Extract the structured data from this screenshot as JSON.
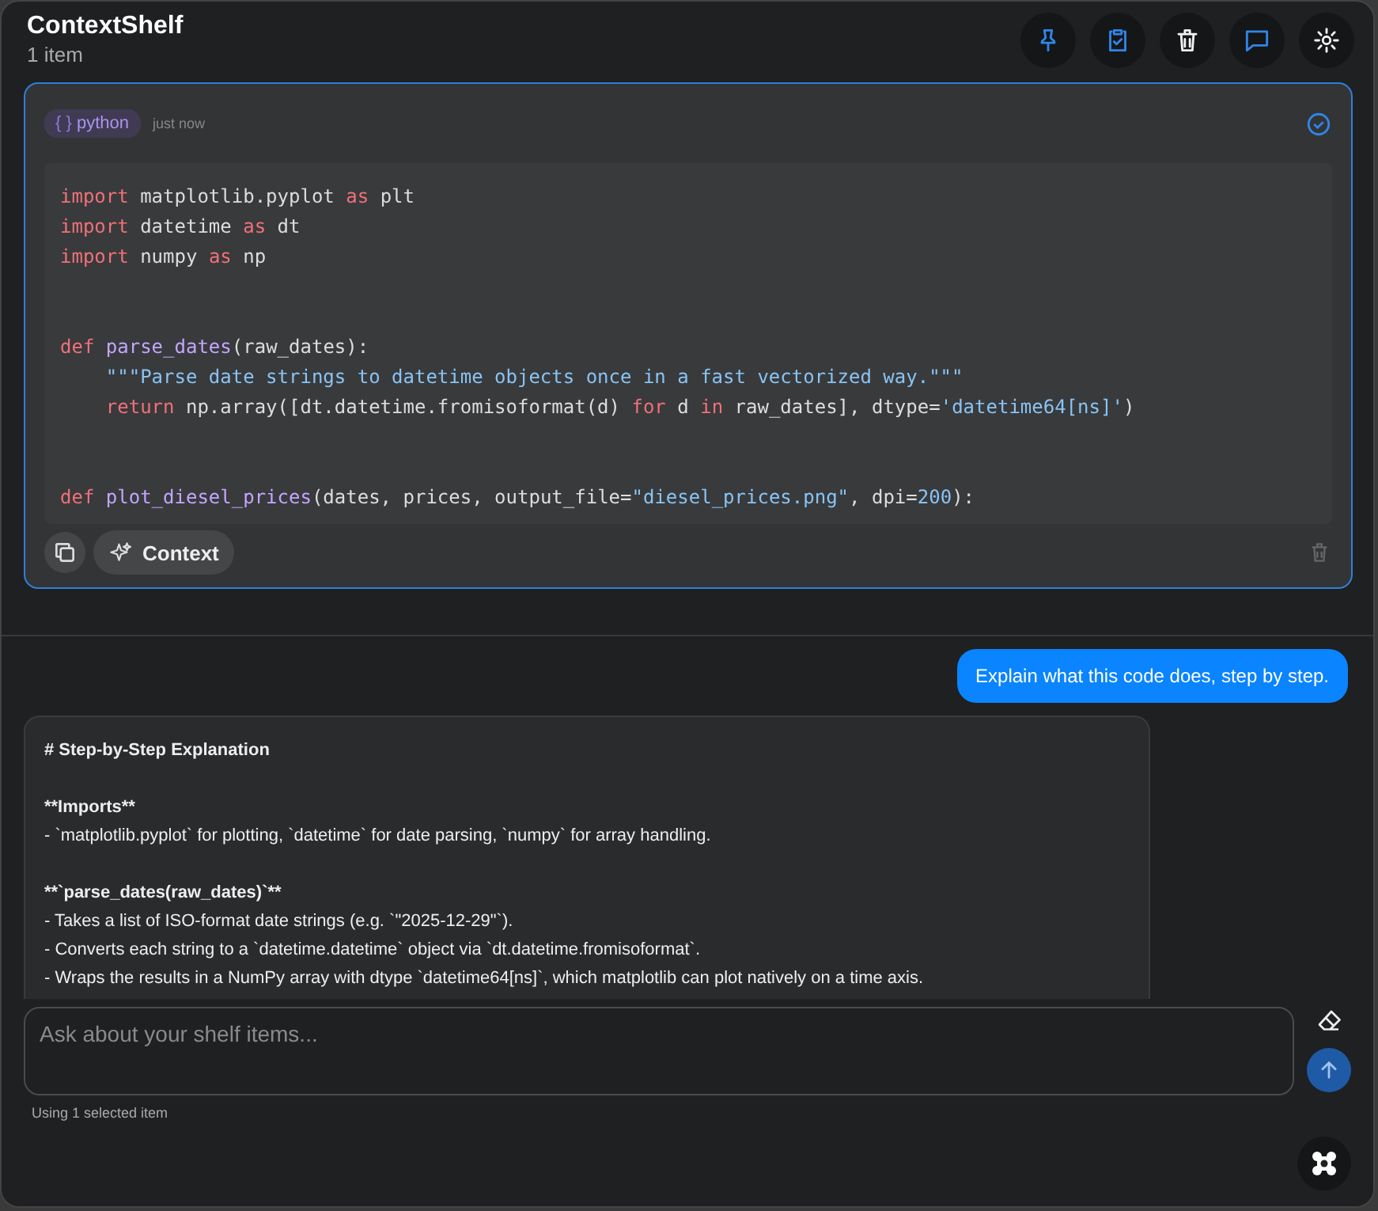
{
  "header": {
    "title": "ContextShelf",
    "subtitle": "1 item"
  },
  "toolbar": [
    {
      "kind": "pin",
      "on": true
    },
    {
      "kind": "clipboard-check",
      "on": true
    },
    {
      "kind": "trash",
      "on": false
    },
    {
      "kind": "chat",
      "on": true
    },
    {
      "kind": "settings",
      "on": false
    }
  ],
  "shelf_item": {
    "language_icon": "{ }",
    "language": "python",
    "time": "just now",
    "selected": true,
    "code_blocks": [
      [
        [
          {
            "text": "import",
            "kind": "keyword"
          },
          {
            "text": " matplotlib.pyplot ",
            "kind": "plain"
          },
          {
            "text": "as",
            "kind": "keyword"
          },
          {
            "text": " plt",
            "kind": "plain"
          }
        ],
        [
          {
            "text": "import",
            "kind": "keyword"
          },
          {
            "text": " datetime ",
            "kind": "plain"
          },
          {
            "text": "as",
            "kind": "keyword"
          },
          {
            "text": " dt",
            "kind": "plain"
          }
        ],
        [
          {
            "text": "import",
            "kind": "keyword"
          },
          {
            "text": " numpy ",
            "kind": "plain"
          },
          {
            "text": "as",
            "kind": "keyword"
          },
          {
            "text": " np",
            "kind": "plain"
          }
        ]
      ],
      [
        [
          {
            "text": "def ",
            "kind": "keyword"
          },
          {
            "text": "parse_dates",
            "kind": "function"
          },
          {
            "text": "(raw_dates):",
            "kind": "plain"
          }
        ],
        [
          {
            "text": "    \"\"\"Parse date strings to datetime objects once in a fast vectorized way.\"\"\"",
            "kind": "string"
          }
        ],
        [
          {
            "text": "    return",
            "kind": "keyword"
          },
          {
            "text": " np.array([dt.datetime.fromisoformat(d) ",
            "kind": "plain"
          },
          {
            "text": "for",
            "kind": "keyword"
          },
          {
            "text": " d ",
            "kind": "plain"
          },
          {
            "text": "in",
            "kind": "keyword"
          },
          {
            "text": " raw_dates], dtype=",
            "kind": "plain"
          },
          {
            "text": "'datetime64[ns]'",
            "kind": "string"
          },
          {
            "text": ")",
            "kind": "plain"
          }
        ]
      ],
      [
        [
          {
            "text": "def ",
            "kind": "keyword"
          },
          {
            "text": "plot_diesel_prices",
            "kind": "function"
          },
          {
            "text": "(dates, prices, output_file=",
            "kind": "plain"
          },
          {
            "text": "\"diesel_prices.png\"",
            "kind": "string"
          },
          {
            "text": ", dpi=",
            "kind": "plain"
          },
          {
            "text": "200",
            "kind": "number"
          },
          {
            "text": "):",
            "kind": "plain"
          }
        ]
      ]
    ],
    "context_label": "Context"
  },
  "messages": [
    {
      "kind": "user",
      "text": "Explain what this code does, step by step."
    },
    {
      "kind": "assistant",
      "paragraphs": [
        [
          {
            "text": "# Step-by-Step Explanation",
            "kind": "heading"
          }
        ],
        [
          {
            "text": "**Imports**",
            "kind": "heading"
          },
          {
            "text": "- `matplotlib.pyplot` for plotting, `datetime` for date parsing, `numpy` for array handling.",
            "kind": "text"
          }
        ],
        [
          {
            "text": "**`parse_dates(raw_dates)`**",
            "kind": "heading"
          },
          {
            "text": "- Takes a list of ISO-format date strings (e.g. `\"2025-12-29\"`).",
            "kind": "text"
          },
          {
            "text": "- Converts each string to a `datetime.datetime` object via `dt.datetime.fromisoformat`.",
            "kind": "text"
          },
          {
            "text": "- Wraps the results in a NumPy array with dtype `datetime64[ns]`, which matplotlib can plot natively on a time axis.",
            "kind": "text"
          }
        ]
      ]
    }
  ],
  "composer": {
    "placeholder": "Ask about your shelf items...",
    "status": "Using 1 selected item"
  }
}
